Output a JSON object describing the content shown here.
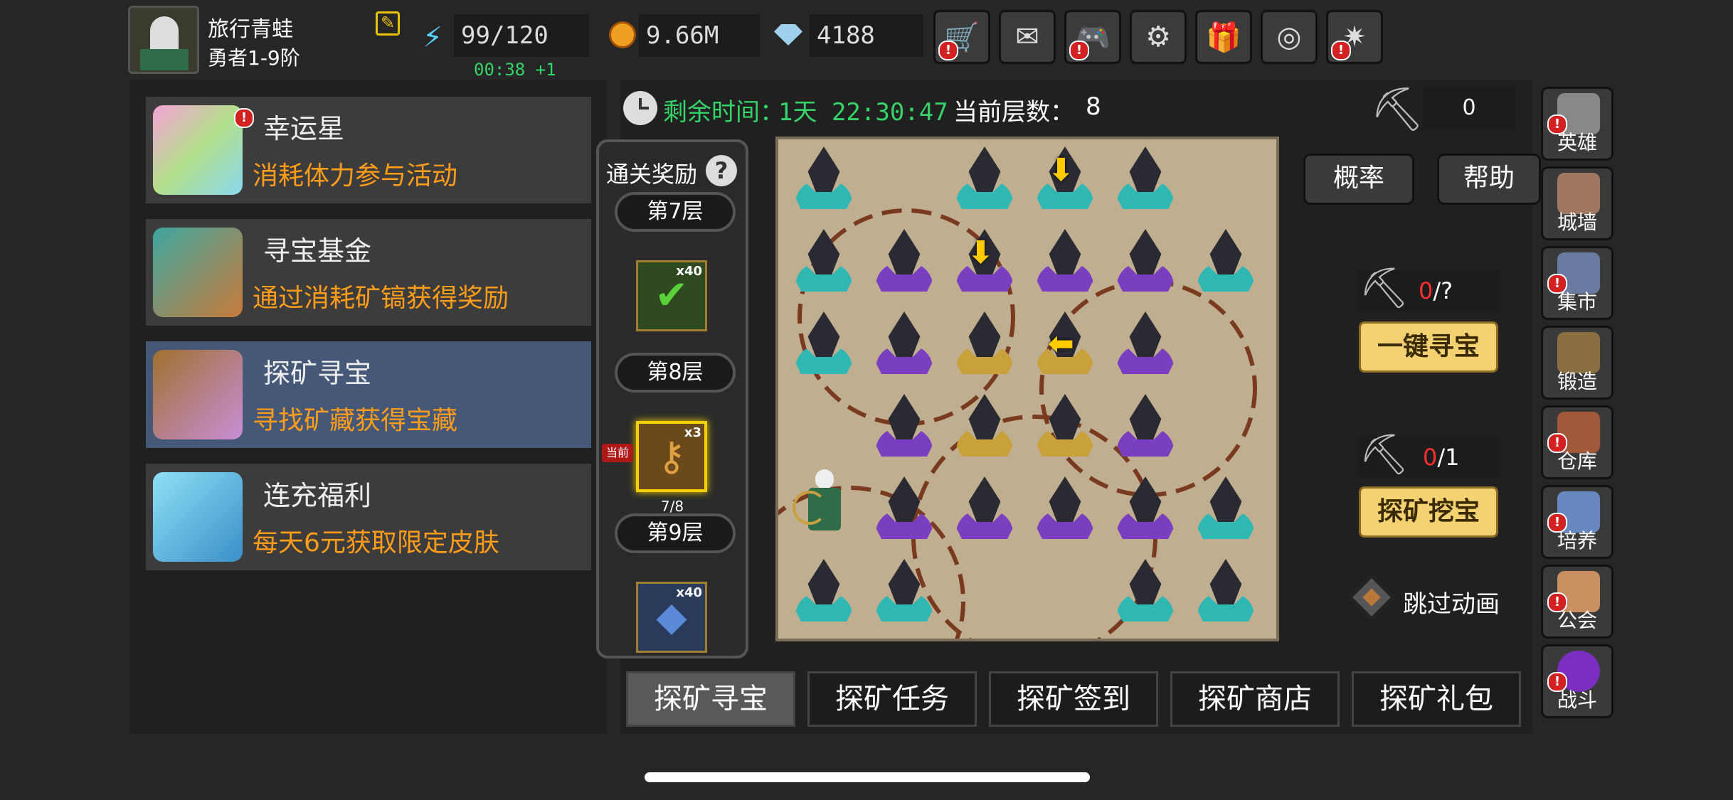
{
  "player": {
    "name": "旅行青蛙",
    "rank": "勇者1-9阶"
  },
  "resources": {
    "stamina": "99/120",
    "stamina_timer": "00:38 +1",
    "gold": "9.66M",
    "gems": "4188"
  },
  "top_buttons": [
    {
      "icon": "cart-icon",
      "alert": true
    },
    {
      "icon": "mail-icon",
      "alert": false
    },
    {
      "icon": "gamepad-icon",
      "alert": true
    },
    {
      "icon": "gear-icon",
      "alert": false
    },
    {
      "icon": "gift-icon",
      "alert": false
    },
    {
      "icon": "color-wheel-icon",
      "alert": false
    },
    {
      "icon": "fireworks-icon",
      "alert": true
    }
  ],
  "events": [
    {
      "title": "幸运星",
      "desc": "消耗体力参与活动",
      "icon": "lucky-star-icon",
      "alert": true,
      "selected": false
    },
    {
      "title": "寻宝基金",
      "desc": "通过消耗矿镐获得奖励",
      "icon": "treasure-bag-icon",
      "alert": false,
      "selected": false
    },
    {
      "title": "探矿寻宝",
      "desc": "寻找矿藏获得宝藏",
      "icon": "treasure-chest-icon",
      "alert": false,
      "selected": true
    },
    {
      "title": "连充福利",
      "desc": "每天6元获取限定皮肤",
      "icon": "ice-crystal-icon",
      "alert": false,
      "selected": false
    }
  ],
  "timer": {
    "label": "剩余时间：",
    "value": "1天 22:30:47",
    "floor_label": "当前层数：",
    "floor_value": "8"
  },
  "pickaxe_count": "0",
  "rewards": {
    "title": "通关奖励",
    "help_glyph": "?",
    "current_tag": "当前",
    "floors": [
      {
        "label": "第7层",
        "quantity": "x40",
        "icon": "pickaxe-check-icon"
      },
      {
        "label": "第8层",
        "quantity": "x3",
        "icon": "golden-key-icon",
        "progress": "7/8"
      },
      {
        "label": "第9层",
        "quantity": "x40",
        "icon": "blue-gem-icon"
      }
    ]
  },
  "buttons": {
    "probability": "概率",
    "help": "帮助",
    "auto_search_count": {
      "have": "0",
      "need": "?"
    },
    "auto_search": "一键寻宝",
    "dig_count": {
      "have": "0",
      "need": "1"
    },
    "dig": "探矿挖宝",
    "skip_anim": "跳过动画"
  },
  "nav": [
    {
      "label": "英雄",
      "icon": "helmet-icon",
      "alert": true
    },
    {
      "label": "城墙",
      "icon": "wall-icon",
      "alert": false
    },
    {
      "label": "集市",
      "icon": "market-icon",
      "alert": true
    },
    {
      "label": "锻造",
      "icon": "anvil-icon",
      "alert": false
    },
    {
      "label": "仓库",
      "icon": "warehouse-icon",
      "alert": true
    },
    {
      "label": "培养",
      "icon": "trophy-icon",
      "alert": true
    },
    {
      "label": "公会",
      "icon": "guild-icon",
      "alert": true
    },
    {
      "label": "战斗",
      "icon": "portal-icon",
      "alert": true
    }
  ],
  "tabs": [
    "探矿寻宝",
    "探矿任务",
    "探矿签到",
    "探矿商店",
    "探矿礼包"
  ],
  "active_tab": 0,
  "map": {
    "crystals": [
      {
        "row": 0,
        "col": 0,
        "color": "teal"
      },
      {
        "row": 0,
        "col": 2,
        "color": "teal"
      },
      {
        "row": 0,
        "col": 3,
        "color": "teal",
        "arrow": "down"
      },
      {
        "row": 0,
        "col": 4,
        "color": "teal"
      },
      {
        "row": 1,
        "col": 0,
        "color": "teal"
      },
      {
        "row": 1,
        "col": 1,
        "color": "purple"
      },
      {
        "row": 1,
        "col": 2,
        "color": "purple",
        "arrow": "down"
      },
      {
        "row": 1,
        "col": 3,
        "color": "purple"
      },
      {
        "row": 1,
        "col": 4,
        "color": "purple"
      },
      {
        "row": 1,
        "col": 5,
        "color": "teal"
      },
      {
        "row": 2,
        "col": 0,
        "color": "teal"
      },
      {
        "row": 2,
        "col": 1,
        "color": "purple"
      },
      {
        "row": 2,
        "col": 2,
        "color": "gold"
      },
      {
        "row": 2,
        "col": 3,
        "color": "gold",
        "arrow": "left"
      },
      {
        "row": 2,
        "col": 4,
        "color": "purple"
      },
      {
        "row": 3,
        "col": 1,
        "color": "purple"
      },
      {
        "row": 3,
        "col": 2,
        "color": "gold"
      },
      {
        "row": 3,
        "col": 3,
        "color": "gold"
      },
      {
        "row": 3,
        "col": 4,
        "color": "purple"
      },
      {
        "row": 4,
        "col": 1,
        "color": "purple"
      },
      {
        "row": 4,
        "col": 2,
        "color": "purple"
      },
      {
        "row": 4,
        "col": 3,
        "color": "purple"
      },
      {
        "row": 4,
        "col": 4,
        "color": "purple"
      },
      {
        "row": 4,
        "col": 5,
        "color": "teal"
      },
      {
        "row": 5,
        "col": 0,
        "color": "teal"
      },
      {
        "row": 5,
        "col": 1,
        "color": "teal"
      },
      {
        "row": 5,
        "col": 4,
        "color": "teal"
      },
      {
        "row": 5,
        "col": 5,
        "color": "teal"
      }
    ],
    "player_cell": {
      "row": 4,
      "col": 0
    },
    "colors": {
      "teal": "#2fb7b4",
      "purple": "#7a3fc0",
      "gold": "#c9a13a"
    }
  }
}
